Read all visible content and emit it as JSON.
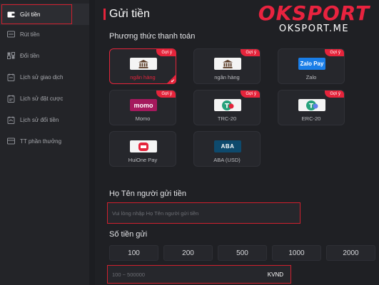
{
  "sidebar": {
    "items": [
      {
        "label": "Gửi tiền",
        "icon": "wallet-icon"
      },
      {
        "label": "Rút tiền",
        "icon": "withdraw-icon"
      },
      {
        "label": "Đổi tiền",
        "icon": "exchange-icon"
      },
      {
        "label": "Lịch sử giao dịch",
        "icon": "history-icon"
      },
      {
        "label": "Lịch sử đặt cược",
        "icon": "bet-history-icon"
      },
      {
        "label": "Lịch sử đổi tiền",
        "icon": "exchange-history-icon"
      },
      {
        "label": "TT phần thưởng",
        "icon": "reward-icon"
      }
    ]
  },
  "header": {
    "title": "Gửi tiền",
    "brand": "OKSPORT",
    "brand_url": "OKSPORT.ME"
  },
  "payment": {
    "section_label": "Phương thức thanh toán",
    "tag": "Gợi ý",
    "methods": [
      {
        "label": "ngân hàng",
        "logo": "bank-icon",
        "tag": true,
        "selected": true
      },
      {
        "label": "ngân hàng",
        "logo": "bank-icon",
        "tag": true
      },
      {
        "label": "Zalo",
        "logo_text": "Zalo Pay",
        "tag": true
      },
      {
        "label": "Momo",
        "logo_text": "momo",
        "tag": true
      },
      {
        "label": "TRC-20",
        "logo": "tether-icon",
        "tag": true
      },
      {
        "label": "ERC-20",
        "logo": "tether-icon",
        "tag": true
      },
      {
        "label": "HuiOne Pay",
        "logo": "huione-icon",
        "tag": false
      },
      {
        "label": "ABA (USD)",
        "logo_text": "ABA",
        "tag": false
      }
    ]
  },
  "sender": {
    "label": "Họ Tên người gửi tiền",
    "placeholder": "Vui lòng nhập Họ Tên người gửi tiền"
  },
  "amount": {
    "label": "Số tiền gửi",
    "presets": [
      "100",
      "200",
      "500",
      "1000",
      "2000"
    ],
    "placeholder": "100 ~ 500000",
    "unit": "KVND"
  },
  "colors": {
    "accent": "#e5243b",
    "background": "#1c1d21",
    "card": "#26272c"
  }
}
